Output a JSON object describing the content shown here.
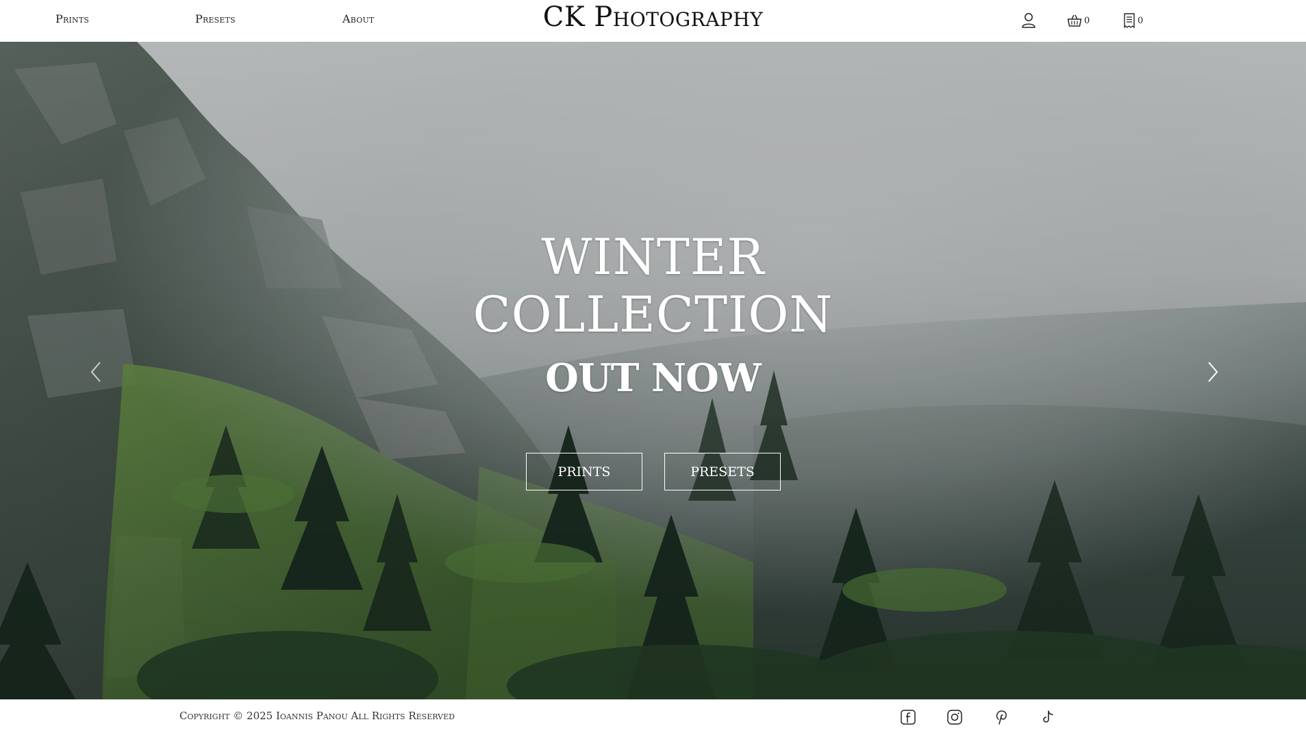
{
  "header": {
    "nav": [
      {
        "label": "Prints"
      },
      {
        "label": "Presets"
      },
      {
        "label": "About"
      }
    ],
    "brand": "CK Photography",
    "cart_count": "0",
    "orders_count": "0",
    "icons": [
      "user-icon",
      "basket-icon",
      "receipt-icon"
    ]
  },
  "hero": {
    "title_line1": "WINTER",
    "title_line2": "COLLECTION",
    "title_line3": "OUT NOW",
    "buttons": {
      "prints": "PRINTS",
      "presets": "PRESETS"
    },
    "arrows": [
      "chevron-left-icon",
      "chevron-right-icon"
    ]
  },
  "footer": {
    "copyright": "Copyright © 2025 Ioannis Panou All Rights Reserved",
    "social": [
      "facebook-icon",
      "instagram-icon",
      "pinterest-icon",
      "tiktok-icon"
    ]
  },
  "colors": {
    "text_dark": "#222222",
    "hero_text": "#ffffff",
    "fog": "#c3c7c8",
    "forest": "#2f4536"
  }
}
